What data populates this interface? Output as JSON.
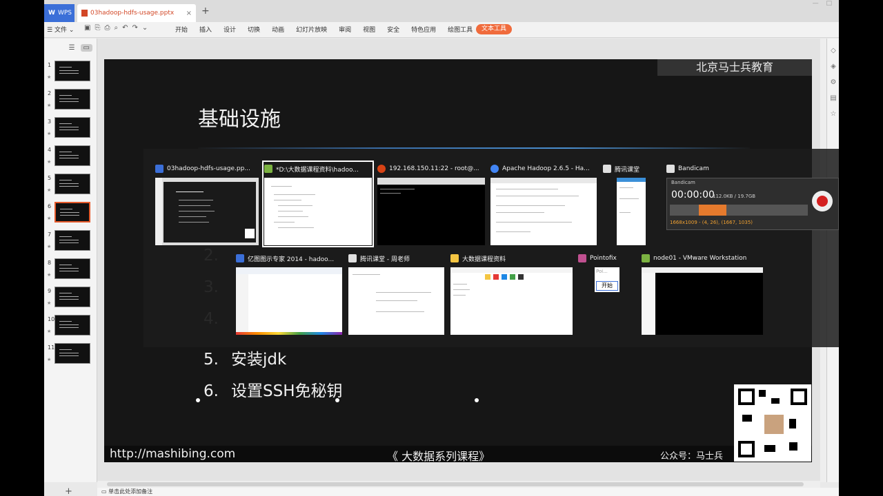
{
  "tabs": {
    "wps": "WPS",
    "doc": "03hadoop-hdfs-usage.pptx",
    "add": "+"
  },
  "menubar": {
    "file": "文件",
    "items": [
      "开始",
      "插入",
      "设计",
      "切换",
      "动画",
      "幻灯片放映",
      "审阅",
      "视图",
      "安全",
      "特色应用",
      "绘图工具"
    ],
    "active": "文本工具"
  },
  "thumbnails": {
    "numbers": [
      "1",
      "2",
      "3",
      "4",
      "5",
      "6",
      "7",
      "8",
      "9",
      "10",
      "11"
    ],
    "selected": "6",
    "star": "★"
  },
  "slide": {
    "brand": "北京马士兵教育",
    "title": "基础设施",
    "bullets": [
      {
        "num": "5.",
        "text": "安装jdk"
      },
      {
        "num": "6.",
        "text": "设置SSH免秘钥"
      }
    ],
    "partial_bullets": [
      "2.",
      "3.",
      "4."
    ],
    "footer": {
      "url": "http://mashibing.com",
      "course": "《 大数据系列课程》",
      "pub": "公众号：马士兵"
    }
  },
  "switcher": {
    "row1": [
      {
        "title": "03hadoop-hdfs-usage.pp...",
        "icon": "wps-presentation-icon",
        "color": "#3b6fd8"
      },
      {
        "title": "*D:\\大数据课程资料\\hadoo...",
        "icon": "notepad-icon",
        "color": "#7cb342"
      },
      {
        "title": "192.168.150.11:22 - root@...",
        "icon": "terminal-icon",
        "color": "#d84315"
      },
      {
        "title": "Apache Hadoop 2.6.5 - Ha...",
        "icon": "chrome-icon",
        "color": "#4285f4"
      },
      {
        "title": "腾讯课堂",
        "icon": "tencent-class-icon",
        "color": "#e0e0e0"
      },
      {
        "title": "Bandicam",
        "icon": "bandicam-icon",
        "color": "#e0e0e0"
      }
    ],
    "row2": [
      {
        "title": "亿图图示专家 2014 - hadoo...",
        "icon": "edraw-icon",
        "color": "#3b6fd8"
      },
      {
        "title": "腾讯课堂 - 周老师",
        "icon": "tencent-class-icon",
        "color": "#e0e0e0"
      },
      {
        "title": "大数据课程资料",
        "icon": "folder-icon",
        "color": "#f4c542"
      },
      {
        "title": "Pointofix",
        "icon": "pointofix-icon",
        "color": "#c05090"
      },
      {
        "title": "node01 - VMware Workstation",
        "icon": "vmware-icon",
        "color": "#7cb342"
      }
    ],
    "bandicam": {
      "time": "00:00:00",
      "size": "112.0KB / 19.7GB",
      "resolution": "1668x1009 - (4, 26), (1667, 1035)"
    },
    "pointofix": {
      "label": "Poi...",
      "start": "开始"
    }
  },
  "notes": {
    "placeholder": "单击此处添加备注",
    "add": "+"
  }
}
